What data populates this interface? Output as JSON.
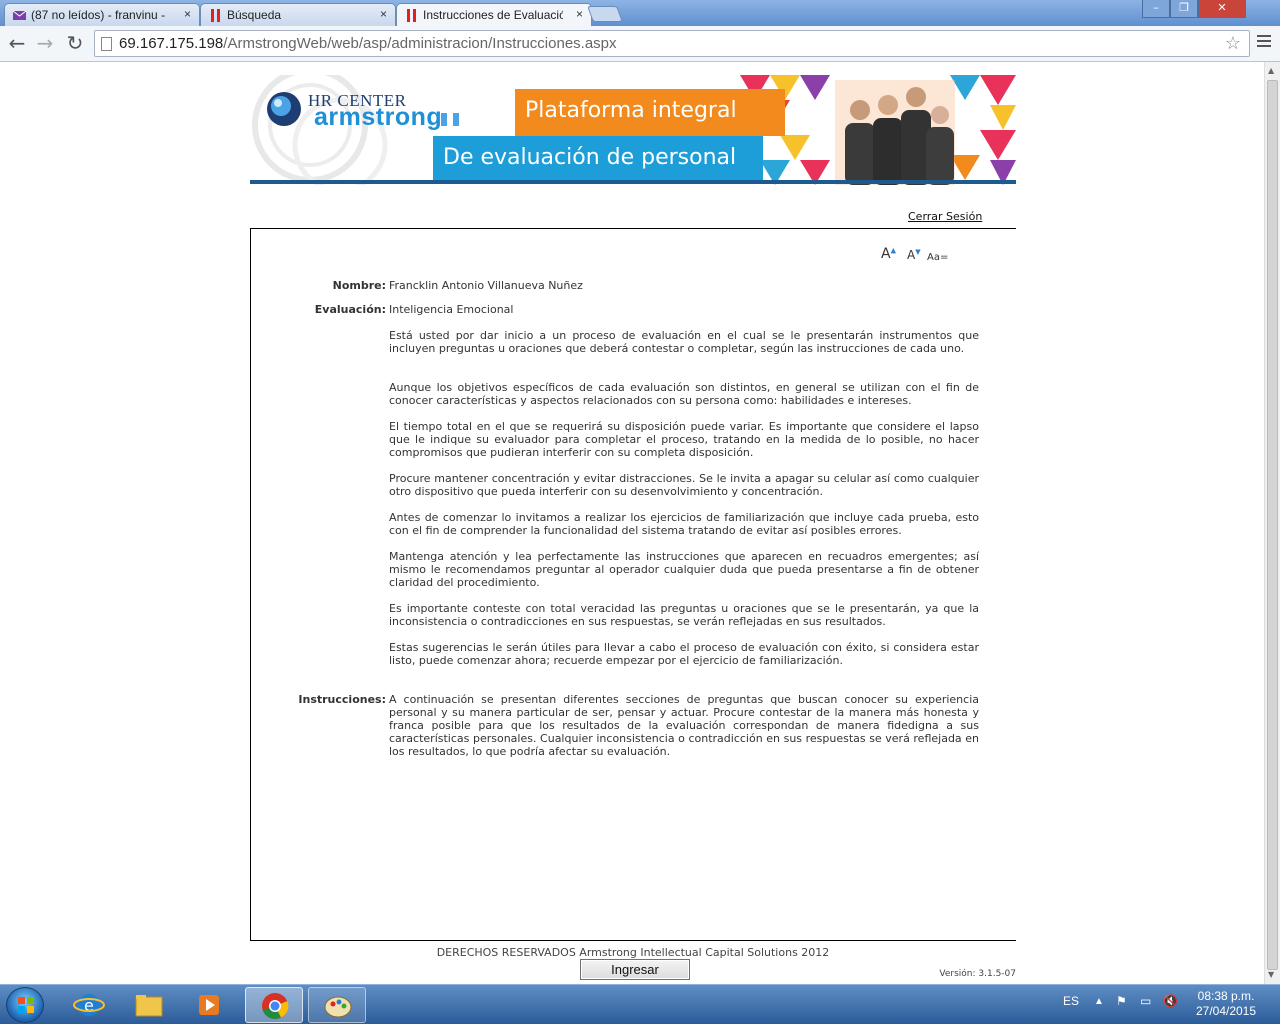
{
  "browser": {
    "tabs": [
      {
        "label": "(87 no leídos) - franvinu -",
        "icon": "mail-icon",
        "active": false
      },
      {
        "label": "Búsqueda",
        "icon": "site-icon",
        "active": false
      },
      {
        "label": "Instrucciones de Evaluació",
        "icon": "site-icon",
        "active": true
      }
    ],
    "url": {
      "host": "69.167.175.198",
      "path": "/ArmstrongWeb/web/asp/administracion/Instrucciones.aspx"
    },
    "close_glyph": "×"
  },
  "banner": {
    "hr_center": "HR CENTER",
    "armstrong": "armstrong",
    "line1": "Plataforma integral",
    "line2": "De evaluación de personal",
    "colors": {
      "orange": "#f28a1e",
      "blue": "#1e9ed9",
      "navy": "#1d5a8f"
    }
  },
  "header": {
    "logout_label": "Cerrar Sesión"
  },
  "font_controls": {
    "increase": "A",
    "decrease": "A",
    "reset": "Aa="
  },
  "candidate": {
    "name_label": "Nombre:",
    "name_value": "Francklin Antonio Villanueva Nuñez",
    "evaluation_label": "Evaluación:",
    "evaluation_value": "Inteligencia Emocional"
  },
  "paragraphs": [
    "Está usted por dar inicio a un proceso de evaluación en el cual se le presentarán instrumentos que incluyen preguntas u oraciones que deberá contestar o completar, según las instrucciones de cada uno.",
    "Aunque los objetivos específicos de cada evaluación son distintos, en general se utilizan con el fin de conocer características y aspectos relacionados con su persona como: habilidades e intereses.",
    "El tiempo total en el que se requerirá su disposición puede variar. Es importante que considere el lapso que le indique su evaluador para completar el proceso, tratando en la medida de lo posible, no hacer compromisos que pudieran interferir con su completa disposición.",
    "Procure mantener concentración y evitar distracciones. Se le invita a apagar su celular así como cualquier otro dispositivo que pueda interferir con su desenvolvimiento y concentración.",
    "Antes de comenzar lo invitamos a realizar los ejercicios de familiarización que incluye cada prueba, esto con el fin de comprender la funcionalidad del sistema tratando de evitar así posibles errores.",
    "Mantenga atención y lea perfectamente las instrucciones que aparecen en recuadros emergentes; así mismo le recomendamos preguntar al operador cualquier duda que pueda presentarse a fin de obtener claridad del procedimiento.",
    "Es importante conteste con total veracidad las preguntas u oraciones que se le presentarán, ya que la inconsistencia o contradicciones en sus respuestas, se verán reflejadas en sus resultados.",
    "Estas sugerencias le serán útiles para llevar a cabo el proceso de evaluación con éxito, si considera estar listo, puede comenzar ahora; recuerde empezar por el ejercicio de familiarización."
  ],
  "instructions": {
    "label": "Instrucciones:",
    "text": "A continuación se presentan diferentes secciones de preguntas que buscan conocer su experiencia personal y su manera particular de ser, pensar y actuar. Procure contestar de la manera más honesta y franca posible para que los resultados de la evaluación correspondan de manera fidedigna a sus características personales. Cualquier inconsistencia o contradicción en sus respuestas se verá reflejada en los resultados, lo que podría afectar su evaluación."
  },
  "actions": {
    "submit_label": "Ingresar"
  },
  "footer": {
    "copyright": "DERECHOS RESERVADOS Armstrong Intellectual Capital Solutions 2012",
    "version": "Versión: 3.1.5-07"
  },
  "taskbar": {
    "language": "ES",
    "time": "08:38 p.m.",
    "date": "27/04/2015",
    "apps": [
      "internet-explorer-icon",
      "file-explorer-icon",
      "media-player-icon",
      "chrome-icon",
      "paint-icon"
    ]
  }
}
